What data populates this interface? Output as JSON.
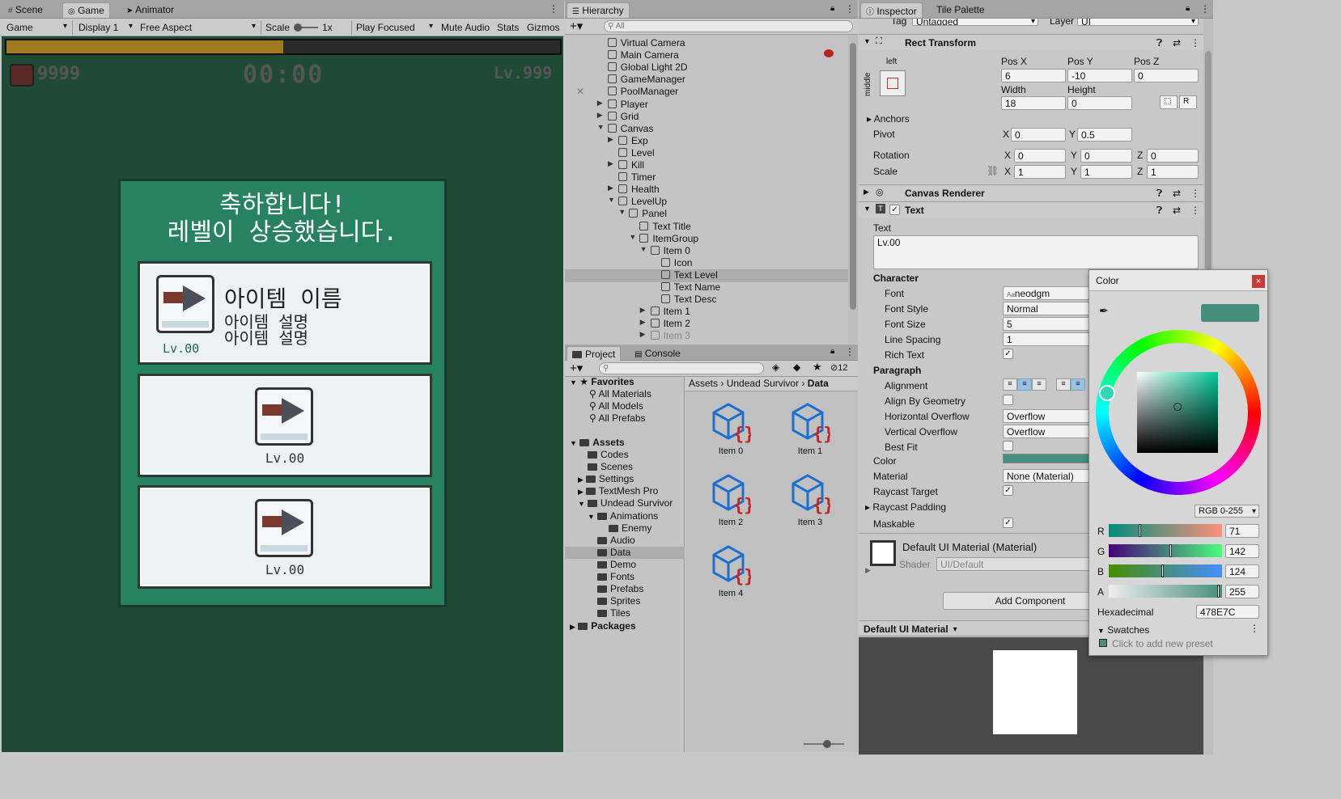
{
  "game_panel": {
    "tabs": [
      {
        "label": "Scene",
        "icon": "grid-icon"
      },
      {
        "label": "Game",
        "icon": "gamepad-icon"
      },
      {
        "label": "Animator",
        "icon": "animator-icon"
      }
    ],
    "toolbar": {
      "mode": "Game",
      "display": "Display 1",
      "aspect": "Free Aspect",
      "scale_label": "Scale",
      "scale_value": "1x",
      "play_focused": "Play Focused",
      "mute": "Mute Audio",
      "stats": "Stats",
      "gizmos": "Gizmos"
    },
    "hud": {
      "kill_count": "9999",
      "timer": "00:00",
      "level": "Lv.999",
      "exp_fill": 0.5
    },
    "levelup": {
      "title_line1": "축하합니다!",
      "title_line2": "레벨이 상승했습니다.",
      "items": [
        {
          "name": "아이템 이름",
          "desc1": "아이템 설명",
          "desc2": "아이템 설명",
          "level": "Lv.00"
        },
        {
          "level": "Lv.00"
        },
        {
          "level": "Lv.00"
        }
      ]
    }
  },
  "hierarchy": {
    "tab": "Hierarchy",
    "search_placeholder": "All",
    "rows": [
      {
        "name": "Virtual Camera"
      },
      {
        "name": "Main Camera"
      },
      {
        "name": "Global Light 2D"
      },
      {
        "name": "GameManager"
      },
      {
        "name": "PoolManager"
      },
      {
        "name": "Player"
      },
      {
        "name": "Grid"
      },
      {
        "name": "Canvas"
      },
      {
        "name": "Exp"
      },
      {
        "name": "Level"
      },
      {
        "name": "Kill"
      },
      {
        "name": "Timer"
      },
      {
        "name": "Health"
      },
      {
        "name": "LevelUp"
      },
      {
        "name": "Panel"
      },
      {
        "name": "Text Title"
      },
      {
        "name": "ItemGroup"
      },
      {
        "name": "Item 0"
      },
      {
        "name": "Icon"
      },
      {
        "name": "Text Level"
      },
      {
        "name": "Text Name"
      },
      {
        "name": "Text Desc"
      },
      {
        "name": "Item 1"
      },
      {
        "name": "Item 2"
      },
      {
        "name": "Item 3"
      }
    ]
  },
  "project": {
    "tabs": [
      "Project",
      "Console"
    ],
    "hidden_count": "12",
    "breadcrumb": [
      "Assets",
      "Undead Survivor",
      "Data"
    ],
    "favorites": {
      "label": "Favorites",
      "items": [
        "All Materials",
        "All Models",
        "All Prefabs"
      ]
    },
    "assets_label": "Assets",
    "folders": [
      "Codes",
      "Scenes",
      "Settings",
      "TextMesh Pro",
      "Undead Survivor",
      "Animations",
      "Enemy",
      "Audio",
      "Data",
      "Demo",
      "Fonts",
      "Prefabs",
      "Sprites",
      "Tiles"
    ],
    "packages_label": "Packages",
    "files": [
      "Item 0",
      "Item 1",
      "Item 2",
      "Item 3",
      "Item 4"
    ]
  },
  "inspector": {
    "tabs": [
      "Inspector",
      "Tile Palette"
    ],
    "tag_label": "Tag",
    "tag_value": "Untagged",
    "layer_label": "Layer",
    "layer_value": "UI",
    "rect": {
      "title": "Rect Transform",
      "anchor_h": "left",
      "anchor_v": "middle",
      "pos_x_label": "Pos X",
      "pos_y_label": "Pos Y",
      "pos_z_label": "Pos Z",
      "pos_x": "6",
      "pos_y": "-10",
      "pos_z": "0",
      "width_label": "Width",
      "height_label": "Height",
      "width": "18",
      "height": "0",
      "r_button": "R",
      "anchors": "Anchors",
      "pivot": "Pivot",
      "pivot_x": "0",
      "pivot_y": "0.5",
      "rotation": "Rotation",
      "rot_x": "0",
      "rot_y": "0",
      "rot_z": "0",
      "scale": "Scale",
      "scale_x": "1",
      "scale_y": "1",
      "scale_z": "1",
      "x": "X",
      "y": "Y",
      "z": "Z"
    },
    "canvas_renderer": "Canvas Renderer",
    "text_comp": {
      "title": "Text",
      "text_label": "Text",
      "text_value": "Lv.00",
      "character": "Character",
      "font_label": "Font",
      "font_value": "neodgm",
      "font_style_label": "Font Style",
      "font_style_value": "Normal",
      "font_size_label": "Font Size",
      "font_size_value": "5",
      "line_spacing_label": "Line Spacing",
      "line_spacing_value": "1",
      "rich_text_label": "Rich Text",
      "paragraph": "Paragraph",
      "alignment_label": "Alignment",
      "align_geom_label": "Align By Geometry",
      "h_overflow_label": "Horizontal Overflow",
      "h_overflow_value": "Overflow",
      "v_overflow_label": "Vertical Overflow",
      "v_overflow_value": "Overflow",
      "best_fit_label": "Best Fit",
      "color_label": "Color",
      "material_label": "Material",
      "material_value": "None (Material)",
      "raycast_target_label": "Raycast Target",
      "raycast_padding_label": "Raycast Padding",
      "maskable_label": "Maskable"
    },
    "material": {
      "name": "Default UI Material (Material)",
      "shader_label": "Shader",
      "shader_value": "UI/Default"
    },
    "add_component": "Add Component",
    "preview_title": "Default UI Material"
  },
  "color_picker": {
    "title": "Color",
    "mode": "RGB 0-255",
    "r_label": "R",
    "g_label": "G",
    "b_label": "B",
    "a_label": "A",
    "r": "71",
    "g": "142",
    "b": "124",
    "a": "255",
    "hex_label": "Hexadecimal",
    "hex": "478E7C",
    "swatches_label": "Swatches",
    "swatch_hint": "Click to add new preset",
    "current_color": "#478E7C"
  }
}
